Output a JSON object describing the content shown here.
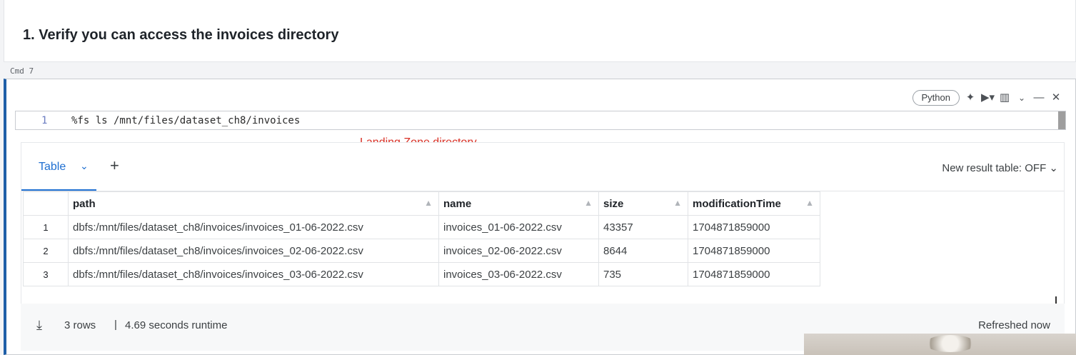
{
  "markdown": {
    "title": "1. Verify you can access the invoices directory"
  },
  "cmd_label": "Cmd 7",
  "toolbar": {
    "language": "Python",
    "icons": [
      "sparkle-icon",
      "run-icon",
      "chart-icon",
      "chevron-down-icon",
      "minimize-icon",
      "close-icon"
    ]
  },
  "editor": {
    "line_number": "1",
    "code": "%fs ls /mnt/files/dataset_ch8/invoices"
  },
  "annotation": "Landing Zone directory",
  "results": {
    "tab_label": "Table",
    "new_result_table": "New result table: OFF",
    "columns": [
      "path",
      "name",
      "size",
      "modificationTime"
    ],
    "rows": [
      {
        "index": "1",
        "path": "dbfs:/mnt/files/dataset_ch8/invoices/invoices_01-06-2022.csv",
        "name": "invoices_01-06-2022.csv",
        "size": "43357",
        "modificationTime": "1704871859000"
      },
      {
        "index": "2",
        "path": "dbfs:/mnt/files/dataset_ch8/invoices/invoices_02-06-2022.csv",
        "name": "invoices_02-06-2022.csv",
        "size": "8644",
        "modificationTime": "1704871859000"
      },
      {
        "index": "3",
        "path": "dbfs:/mnt/files/dataset_ch8/invoices/invoices_03-06-2022.csv",
        "name": "invoices_03-06-2022.csv",
        "size": "735",
        "modificationTime": "1704871859000"
      }
    ]
  },
  "footer": {
    "rows": "3 rows",
    "separator": "|",
    "runtime": "4.69 seconds runtime",
    "refreshed": "Refreshed now"
  },
  "colors": {
    "accent": "#1f6fd1",
    "annotation": "#d93025",
    "cell_border": "#1f5fa8"
  }
}
